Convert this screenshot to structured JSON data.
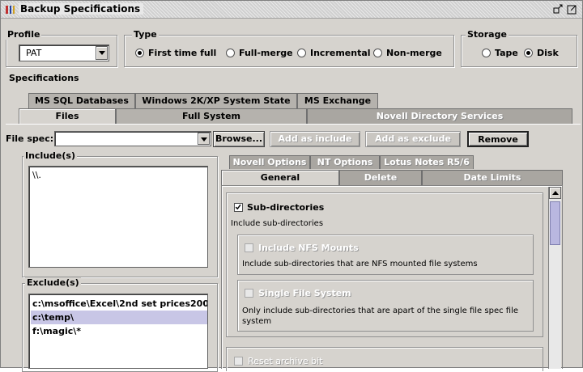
{
  "window": {
    "title": "Backup Specifications"
  },
  "profile": {
    "label": "Profile",
    "value": "PAT"
  },
  "type": {
    "label": "Type",
    "options": [
      {
        "label": "First time full",
        "selected": true
      },
      {
        "label": "Full-merge",
        "selected": false
      },
      {
        "label": "Incremental",
        "selected": false
      },
      {
        "label": "Non-merge",
        "selected": false
      }
    ]
  },
  "storage": {
    "label": "Storage",
    "options": [
      {
        "label": "Tape",
        "selected": false
      },
      {
        "label": "Disk",
        "selected": true
      }
    ]
  },
  "specifications": {
    "label": "Specifications",
    "tabs_row1": [
      "MS SQL Databases",
      "Windows 2K/XP System State",
      "MS Exchange"
    ],
    "tabs_row2": [
      "Files",
      "Full System",
      "Novell Directory Services"
    ],
    "selected_tab": "Files"
  },
  "filespec": {
    "label": "File spec:",
    "value": "",
    "browse_label": "Browse...",
    "add_include_label": "Add as include",
    "add_exclude_label": "Add as exclude",
    "remove_label": "Remove"
  },
  "includes": {
    "label": "Include(s)",
    "items": [
      "\\\\."
    ]
  },
  "excludes": {
    "label": "Exclude(s)",
    "items": [
      "c:\\msoffice\\Excel\\2nd set prices200",
      "c:\\temp\\",
      "f:\\magic\\*"
    ],
    "selected_index": 1
  },
  "options": {
    "tabs_row1": [
      "Novell Options",
      "NT Options",
      "Lotus Notes R5/6"
    ],
    "tabs_row2": [
      "General",
      "Delete",
      "Date Limits"
    ],
    "selected_tab": "General",
    "subdirs": {
      "label": "Sub-directories",
      "checked": true,
      "description": "Include sub-directories",
      "nfs_label": "Include NFS Mounts",
      "nfs_description": "Include sub-directories that are NFS mounted file systems",
      "single_label": "Single File System",
      "single_description": "Only include sub-directories that are apart of the single file spec file system"
    },
    "reset_archive_label": "Reset archive bit"
  },
  "colors": {
    "window_bg": "#d6d3ce",
    "selection": "#c8c6e6",
    "scrollbar": "#b9b7e0"
  }
}
